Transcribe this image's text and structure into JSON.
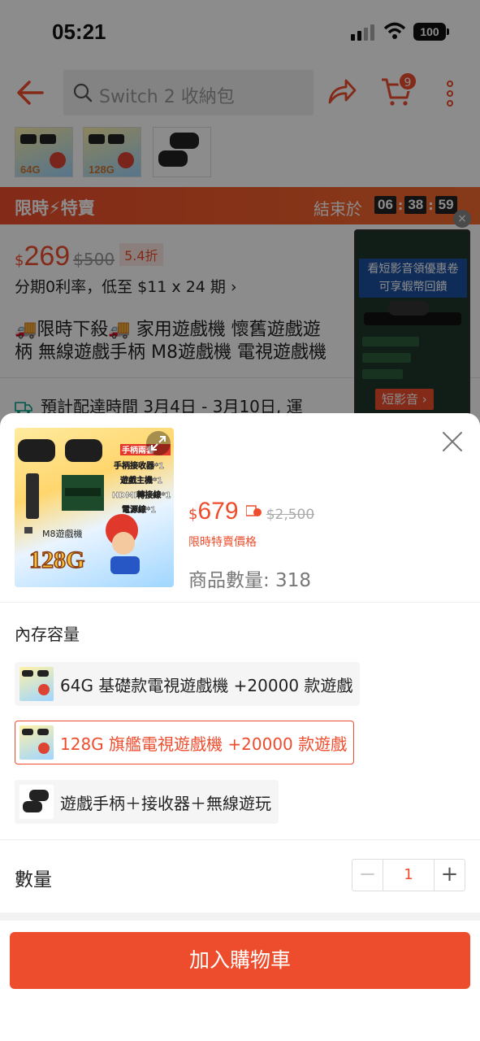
{
  "status_bar": {
    "time": "05:21",
    "battery": "100"
  },
  "nav": {
    "search_placeholder": "Switch 2 收納包",
    "cart_count": "9"
  },
  "thumbs": [
    {
      "label": "64G"
    },
    {
      "label": "128G"
    },
    {
      "label": ""
    }
  ],
  "flash_sale": {
    "title": "限時⚡特賣",
    "ends_label": "結束於",
    "timer": [
      "06",
      "38",
      "59"
    ]
  },
  "price": {
    "currency": "$",
    "amount": "269",
    "original": "$500",
    "discount": "5.4折"
  },
  "installment": "分期0利率，低至 $11 x 24 期 ›",
  "product_title_line1": "🚚限時下殺🚚 家用遊戲機 懷舊遊戲遊",
  "product_title_line2": "柄 無線遊戲手柄 M8遊戲機 電視遊戲機",
  "delivery": "預計配達時間 3月4日 - 3月10日, 運",
  "video_float": {
    "banner_line1": "看短影音領優惠卷",
    "banner_line2": "可享蝦幣回饋",
    "label": "短影音 ›"
  },
  "sheet": {
    "image_texts": [
      "手柄兩套",
      "手柄接收器*1",
      "遊戲主機*1",
      "HDMI轉接線*1",
      "電源線*1",
      "M8遊戲機",
      "128G"
    ],
    "price_currency": "$",
    "price_amount": "679",
    "price_original": "$2,500",
    "flash_price_label": "限時特賣價格",
    "stock": "商品數量: 318",
    "variation_title": "內存容量",
    "variations": [
      {
        "label": "64G 基礎款電視遊戲機 +20000 款遊戲",
        "selected": false
      },
      {
        "label": "128G 旗艦電視遊戲機 +20000 款遊戲",
        "selected": true
      },
      {
        "label": "遊戲手柄＋接收器＋無線遊玩",
        "selected": false
      }
    ],
    "quantity_label": "數量",
    "quantity": "1",
    "add_to_cart": "加入購物車"
  },
  "colors": {
    "accent": "#ee4d2d"
  }
}
